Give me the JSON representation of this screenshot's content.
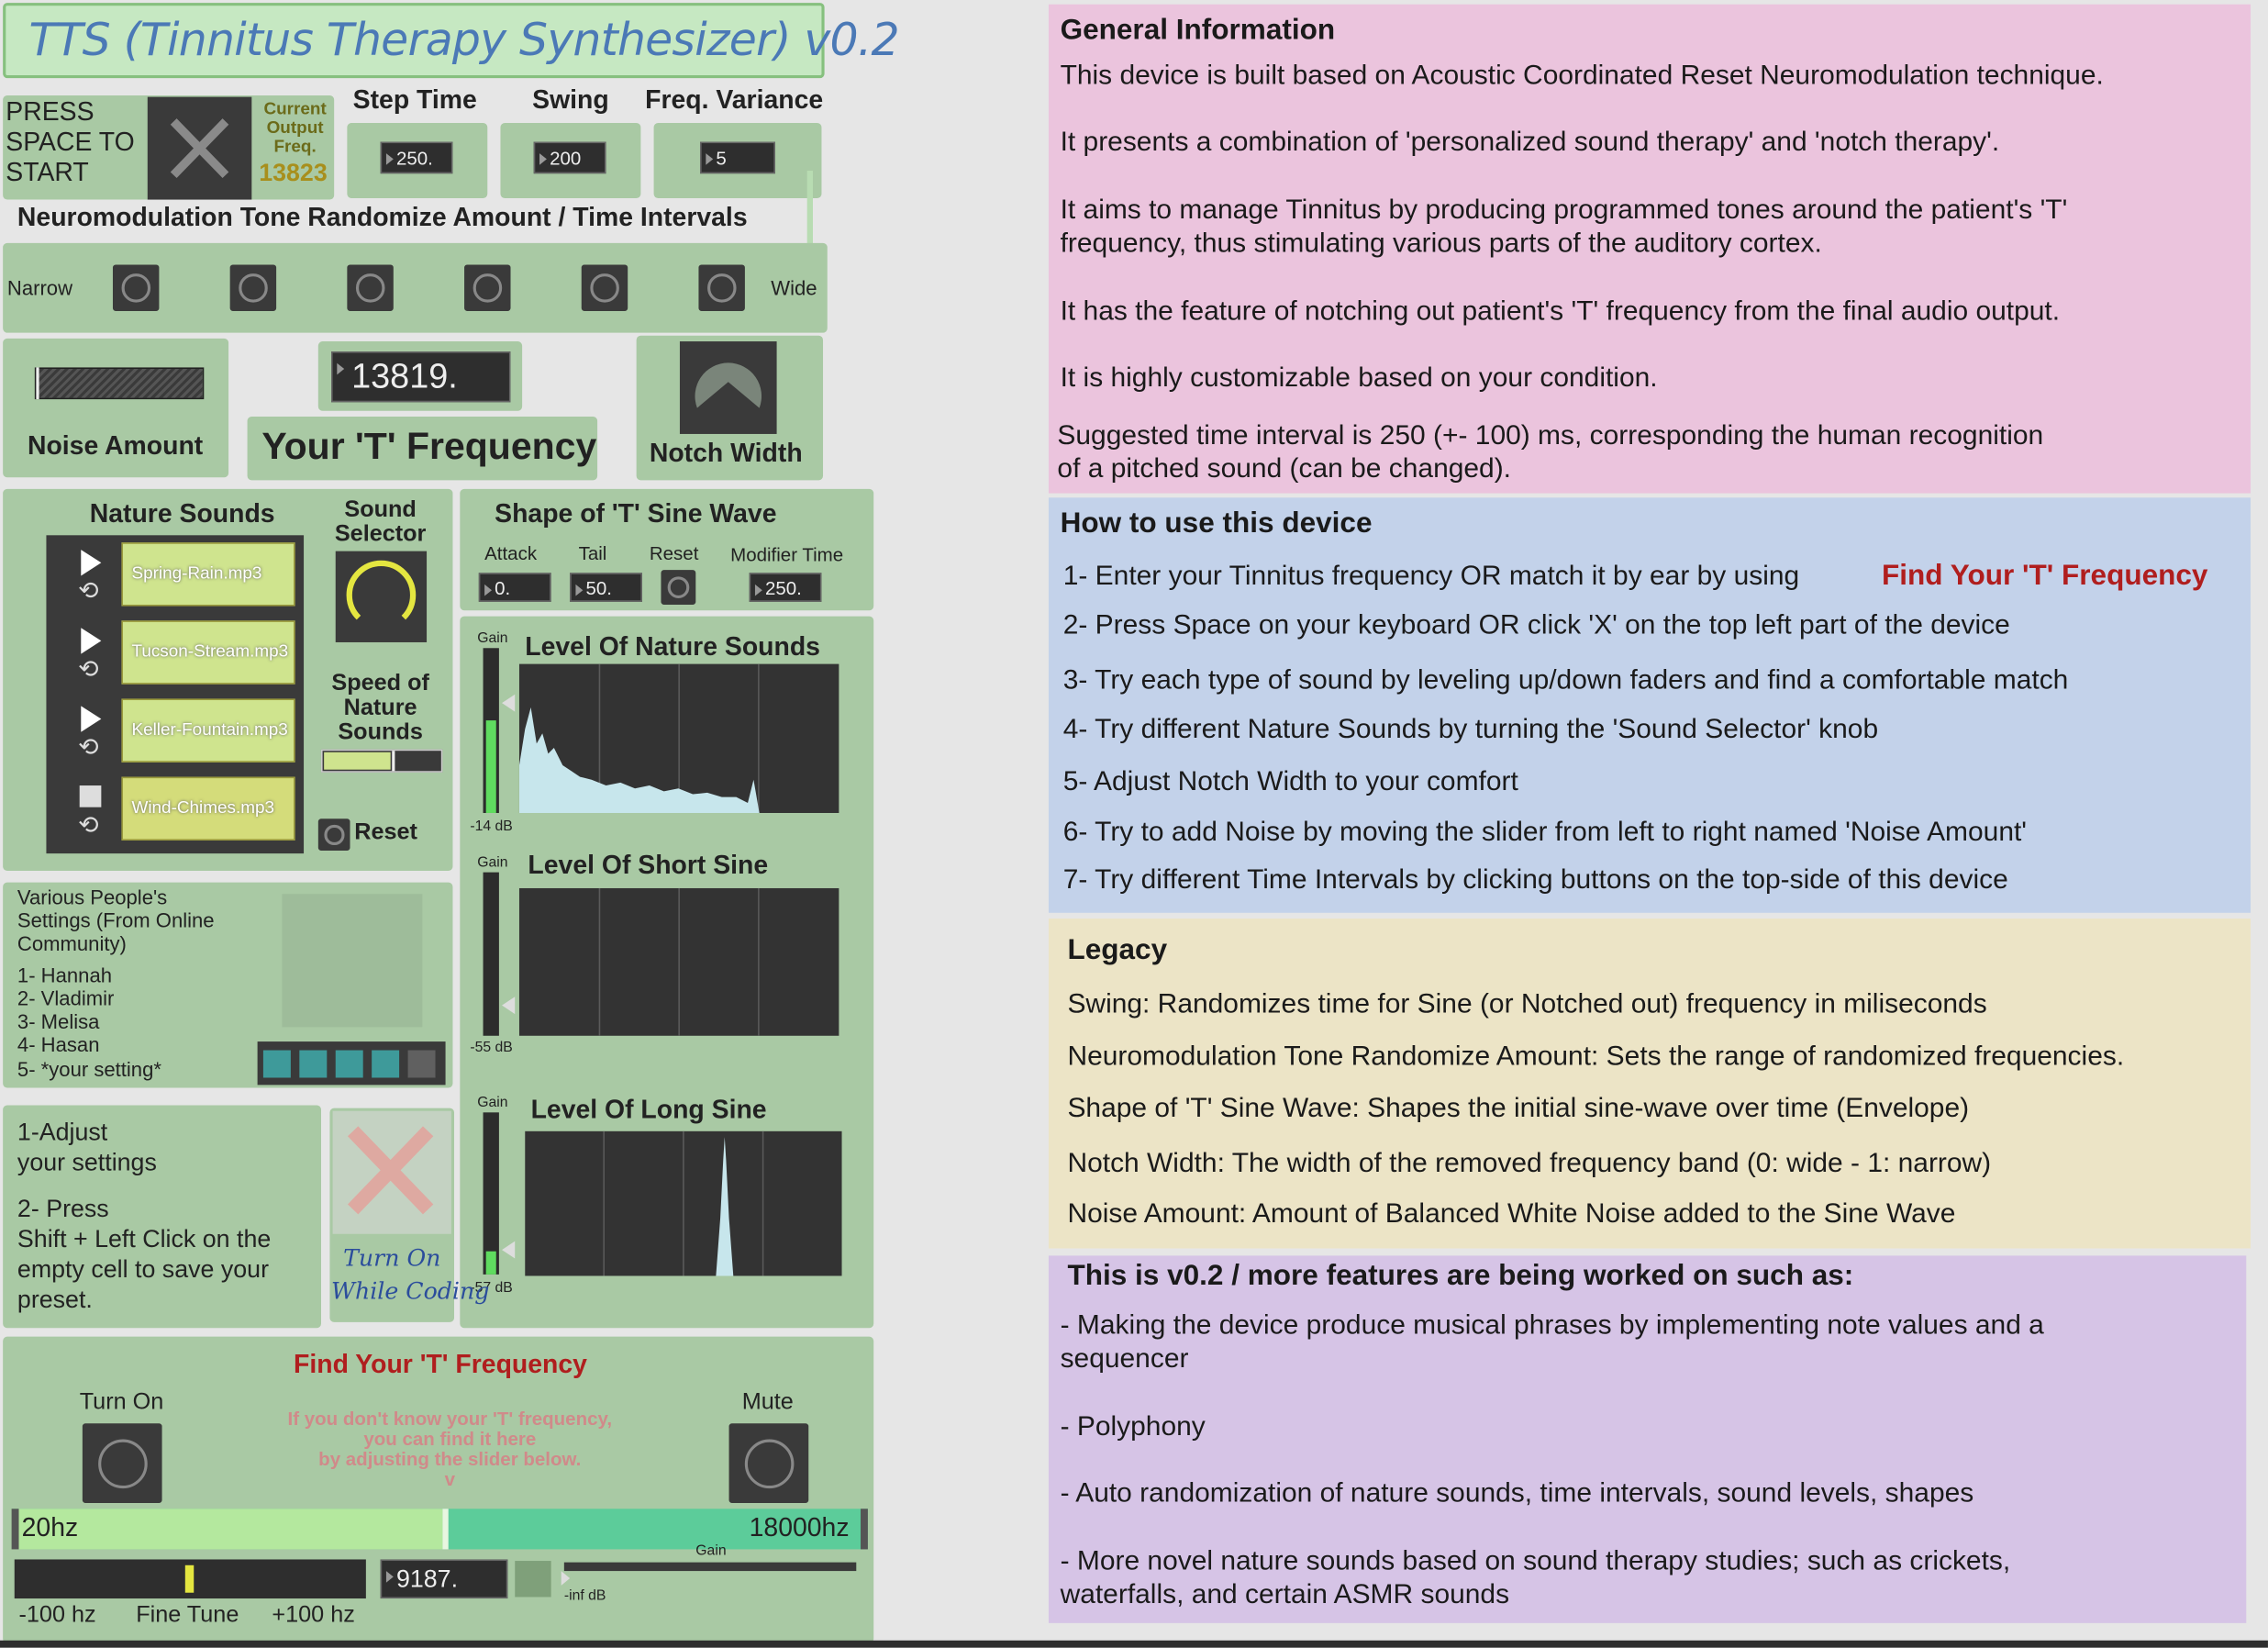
{
  "app": {
    "title": "TTS (Tinnitus Therapy Synthesizer) v0.2"
  },
  "transport": {
    "press_label": "PRESS\nSPACE TO\nSTART",
    "output_label": "Current\nOutput\nFreq.",
    "output_value": "13823"
  },
  "params": {
    "step_time_label": "Step Time",
    "step_time_value": "250.",
    "swing_label": "Swing",
    "swing_value": "200",
    "freq_variance_label": "Freq. Variance",
    "freq_variance_value": "5"
  },
  "neuromod": {
    "title": "Neuromodulation Tone Randomize Amount / Time Intervals",
    "narrow": "Narrow",
    "wide": "Wide"
  },
  "noise": {
    "label": "Noise Amount"
  },
  "tfreq": {
    "value": "13819.",
    "label": "Your 'T' Frequency"
  },
  "notch": {
    "label": "Notch Width"
  },
  "nature": {
    "title": "Nature Sounds",
    "clips": [
      "Spring-Rain.mp3",
      "Tucson-Stream.mp3",
      "Keller-Fountain.mp3",
      "Wind-Chimes.mp3"
    ],
    "selector_label": "Sound\nSelector",
    "speed_label": "Speed of\nNature\nSounds",
    "reset_label": "Reset"
  },
  "shape": {
    "title": "Shape of 'T' Sine Wave",
    "attack_label": "Attack",
    "attack_value": "0.",
    "tail_label": "Tail",
    "tail_value": "50.",
    "reset_label": "Reset",
    "modifier_label": "Modifier Time",
    "modifier_value": "250."
  },
  "levels": {
    "gain": "Gain",
    "nature": {
      "title": "Level Of Nature Sounds",
      "db": "-14 dB"
    },
    "short": {
      "title": "Level Of Short Sine",
      "db": "-55 dB"
    },
    "long": {
      "title": "Level Of Long Sine",
      "db": "-57 dB"
    }
  },
  "presets": {
    "title": "Various People's\nSettings (From Online\nCommunity)",
    "items": [
      "1- Hannah",
      "2- Vladimir",
      "3- Melisa",
      "4- Hasan",
      "5- *your setting*"
    ]
  },
  "instructions": {
    "text1": "1-Adjust\nyour settings",
    "text2": "2- Press\nShift + Left Click on the\nempty cell to save your\npreset."
  },
  "coding": {
    "label": "Turn On\nWhile Coding"
  },
  "find": {
    "title": "Find Your 'T' Frequency",
    "turn_on": "Turn On",
    "mute": "Mute",
    "hint": "If you don't know your 'T' frequency,\nyou can find it here\nby adjusting the slider below.\nv",
    "min": "20hz",
    "max": "18000hz",
    "value": "9187.",
    "fine_min": "-100 hz",
    "fine_label": "Fine Tune",
    "fine_max": "+100 hz",
    "gain": "Gain",
    "inf": "-inf dB"
  },
  "general": {
    "title": "General Information",
    "lines": [
      "This device is built based on Acoustic Coordinated Reset Neuromodulation technique.",
      "It presents a combination of 'personalized sound therapy' and 'notch therapy'.",
      "It aims to manage Tinnitus by producing programmed tones around the patient's 'T'\nfrequency, thus stimulating various parts of the auditory cortex.",
      "It has the feature of notching out patient's 'T' frequency from the final audio output.",
      "It is highly customizable based on your condition.",
      "Suggested time interval is 250 (+- 100) ms, corresponding the human recognition\nof a pitched sound (can be changed)."
    ]
  },
  "howto": {
    "title": "How to use this device",
    "step1": "1- Enter your Tinnitus frequency OR match it by ear by using",
    "step1_link": "Find Your 'T' Frequency",
    "lines": [
      "2- Press Space on your keyboard OR click 'X' on the top left part of the device",
      "3- Try each type of sound by leveling up/down faders and find a comfortable match",
      "4- Try different Nature Sounds by turning the 'Sound Selector' knob",
      "5- Adjust Notch Width to your comfort",
      "6- Try to add Noise by moving the slider from left to right named 'Noise Amount'",
      "7- Try different Time Intervals by clicking buttons on the top-side of this device"
    ]
  },
  "legacy": {
    "title": "Legacy",
    "lines": [
      "Swing: Randomizes time for Sine (or Notched out) frequency in miliseconds",
      "Neuromodulation Tone Randomize Amount: Sets the range of randomized frequencies.",
      "Shape of 'T' Sine Wave: Shapes the initial sine-wave over time (Envelope)",
      "Notch Width: The width of the removed frequency band (0: wide - 1: narrow)",
      "Noise Amount: Amount of Balanced White Noise added to the Sine Wave"
    ]
  },
  "future": {
    "title": "This is v0.2 / more features are being worked on such as:",
    "lines": [
      "- Making the device produce musical phrases by implementing note values and a\nsequencer",
      "- Polyphony",
      "- Auto randomization of nature sounds, time intervals, sound levels, shapes",
      "- More novel nature sounds based on sound therapy studies; such as crickets,\nwaterfalls, and certain ASMR sounds"
    ]
  },
  "colors": {
    "panel": "#a9c9a4",
    "pink": "#ebc4dd",
    "blue": "#c3d2ea",
    "yellow": "#ece4c6",
    "purple": "#d6c4e6",
    "red": "#b01e1e",
    "title_blue": "#4b79b6"
  }
}
